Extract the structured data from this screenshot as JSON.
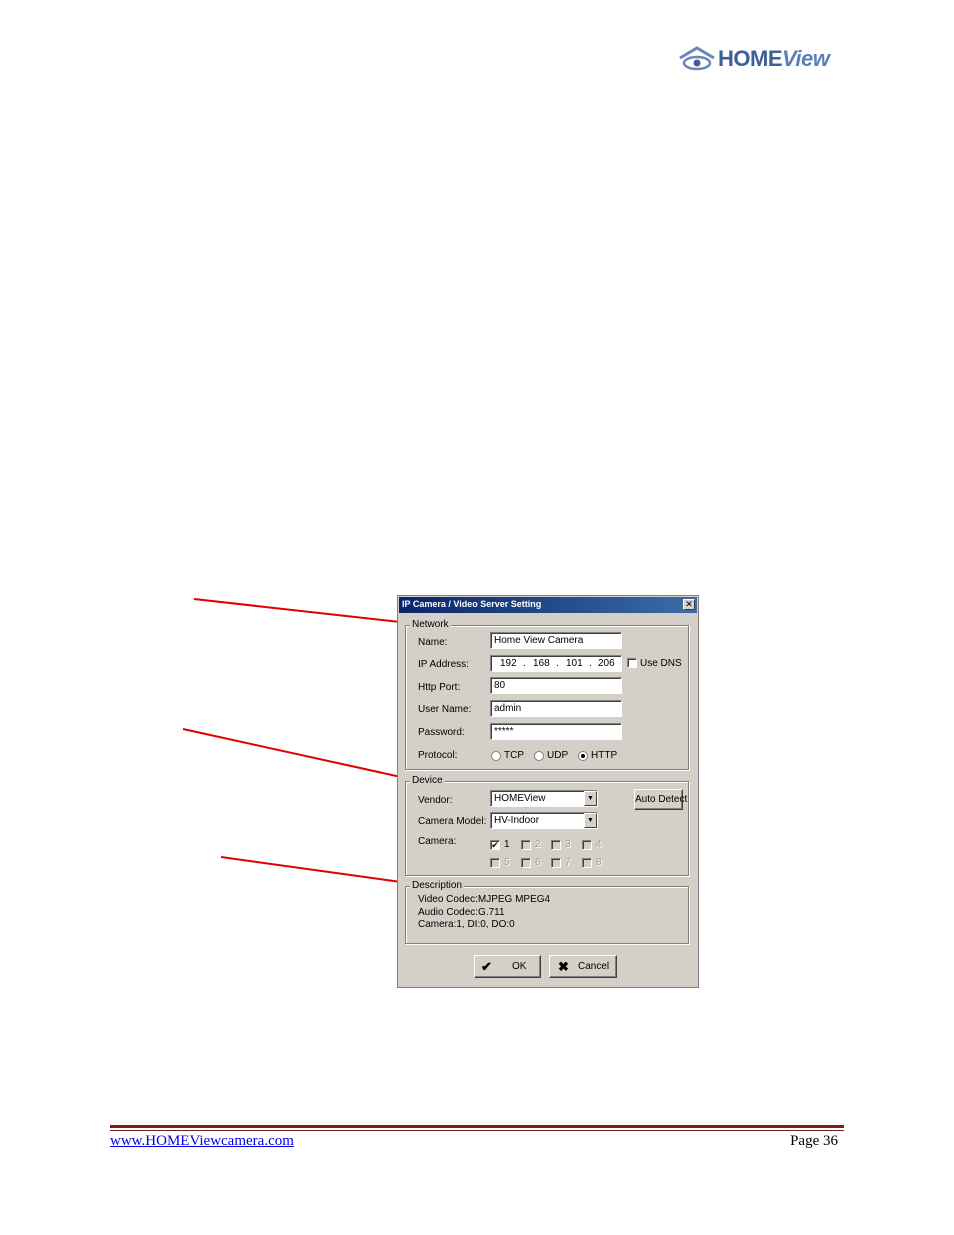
{
  "header": {
    "logo_home": "HOME",
    "logo_view": "View",
    "logo_color": "#3f5f9a"
  },
  "dialog": {
    "title": "IP Camera / Video Server Setting",
    "close_glyph": "✕",
    "network": {
      "legend": "Network",
      "name_label": "Name:",
      "name_value": "Home View Camera",
      "ip_label": "IP Address:",
      "ip_segments": [
        "192",
        "168",
        "101",
        "206"
      ],
      "ip_dot": ".",
      "use_dns_label": "Use DNS",
      "use_dns_checked": false,
      "port_label": "Http Port:",
      "port_value": "80",
      "user_label": "User Name:",
      "user_value": "admin",
      "password_label": "Password:",
      "password_value": "*****",
      "protocol_label": "Protocol:",
      "protocols": [
        {
          "label": "TCP",
          "selected": false
        },
        {
          "label": "UDP",
          "selected": false
        },
        {
          "label": "HTTP",
          "selected": true
        }
      ]
    },
    "device": {
      "legend": "Device",
      "vendor_label": "Vendor:",
      "vendor_value": "HOMEView",
      "auto_detect_label": "Auto Detect",
      "model_label": "Camera Model:",
      "model_value": "HV-Indoor",
      "camera_label": "Camera:",
      "cameras": [
        {
          "label": "1",
          "checked": true,
          "enabled": true
        },
        {
          "label": "2",
          "checked": false,
          "enabled": false
        },
        {
          "label": "3",
          "checked": false,
          "enabled": false
        },
        {
          "label": "4",
          "checked": false,
          "enabled": false
        },
        {
          "label": "5",
          "checked": false,
          "enabled": false
        },
        {
          "label": "6",
          "checked": false,
          "enabled": false
        },
        {
          "label": "7",
          "checked": false,
          "enabled": false
        },
        {
          "label": "8",
          "checked": false,
          "enabled": false
        }
      ]
    },
    "description": {
      "legend": "Description",
      "lines": [
        "Video Codec:MJPEG MPEG4",
        "Audio Codec:G.711",
        "Camera:1, DI:0, DO:0"
      ]
    },
    "ok_label": "OK",
    "cancel_label": "Cancel"
  },
  "footer": {
    "link_text": "www.HOMEViewcamera.com",
    "page_label": "Page 36",
    "rule_color": "#7b1c1c"
  },
  "callout_color": "#e00000"
}
